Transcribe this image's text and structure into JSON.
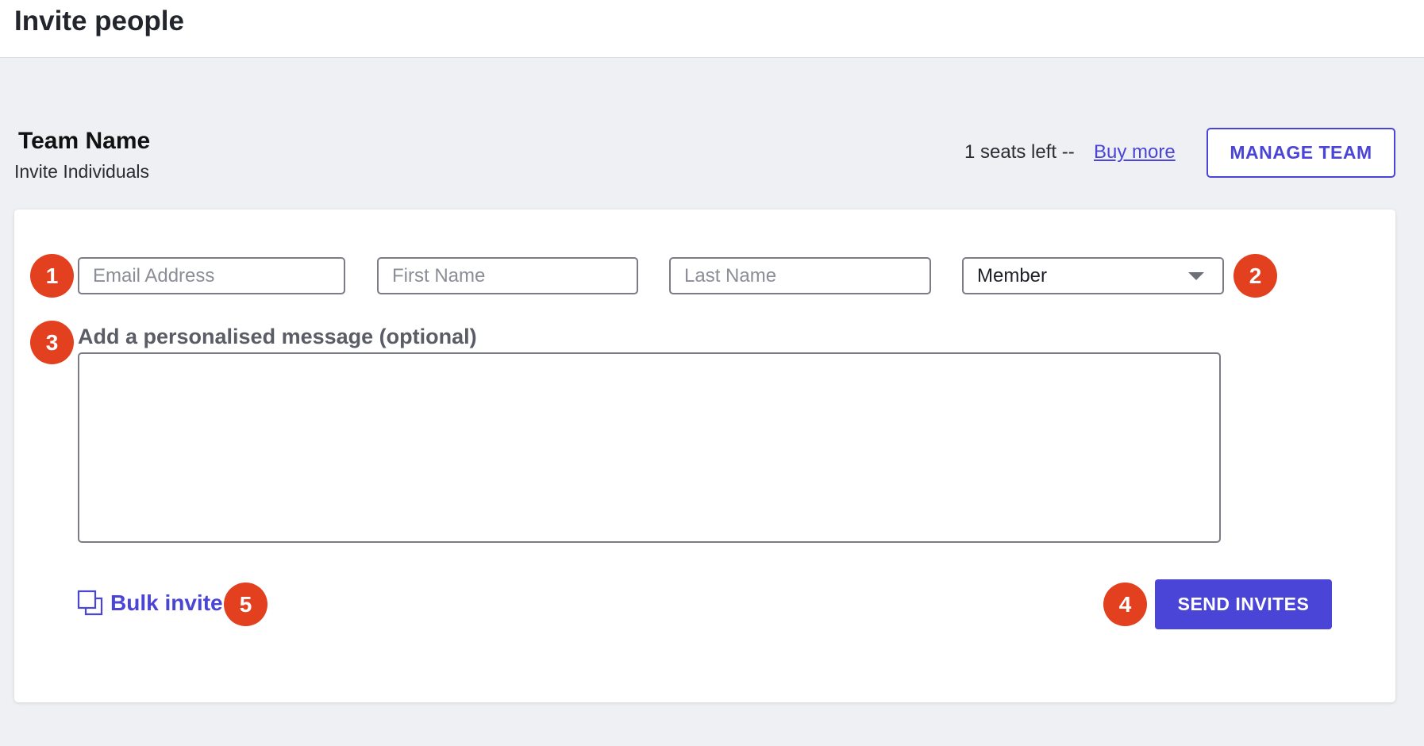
{
  "header": {
    "title": "Invite people"
  },
  "team": {
    "name": "Team Name",
    "subtitle": "Invite Individuals",
    "seats_text": "1 seats left --",
    "buy_more_label": "Buy more",
    "manage_label": "MANAGE TEAM"
  },
  "form": {
    "email_placeholder": "Email Address",
    "first_name_placeholder": "First Name",
    "last_name_placeholder": "Last Name",
    "role_value": "Member",
    "message_label": "Add a personalised message (optional)",
    "message_value": "",
    "bulk_invite_label": "Bulk invite",
    "send_label": "SEND INVITES"
  },
  "badges": [
    "1",
    "2",
    "3",
    "4",
    "5"
  ],
  "colors": {
    "accent": "#4a45d6",
    "badge": "#e2401f",
    "background": "#eef0f4"
  },
  "icons": [
    "chevron-down-icon",
    "copy-icon"
  ]
}
